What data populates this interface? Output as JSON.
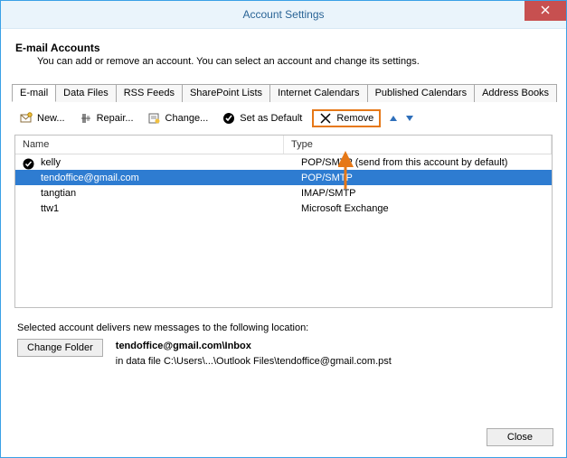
{
  "window": {
    "title": "Account Settings"
  },
  "header": {
    "title": "E-mail Accounts",
    "desc": "You can add or remove an account. You can select an account and change its settings."
  },
  "tabs": {
    "items": [
      {
        "label": "E-mail"
      },
      {
        "label": "Data Files"
      },
      {
        "label": "RSS Feeds"
      },
      {
        "label": "SharePoint Lists"
      },
      {
        "label": "Internet Calendars"
      },
      {
        "label": "Published Calendars"
      },
      {
        "label": "Address Books"
      }
    ],
    "active_index": 0
  },
  "toolbar": {
    "new": "New...",
    "repair": "Repair...",
    "change": "Change...",
    "set_default": "Set as Default",
    "remove": "Remove"
  },
  "columns": {
    "name": "Name",
    "type": "Type"
  },
  "accounts": [
    {
      "name": "kelly",
      "type": "POP/SMTP (send from this account by default)",
      "default": true,
      "selected": false
    },
    {
      "name": "tendoffice@gmail.com",
      "type": "POP/SMTP",
      "default": false,
      "selected": true
    },
    {
      "name": "tangtian",
      "type": "IMAP/SMTP",
      "default": false,
      "selected": false
    },
    {
      "name": "ttw1",
      "type": "Microsoft Exchange",
      "default": false,
      "selected": false
    }
  ],
  "footer": {
    "info": "Selected account delivers new messages to the following location:",
    "change_folder": "Change Folder",
    "path_main": "tendoffice@gmail.com\\Inbox",
    "path_sub": "in data file C:\\Users\\...\\Outlook Files\\tendoffice@gmail.com.pst"
  },
  "buttons": {
    "close": "Close"
  }
}
